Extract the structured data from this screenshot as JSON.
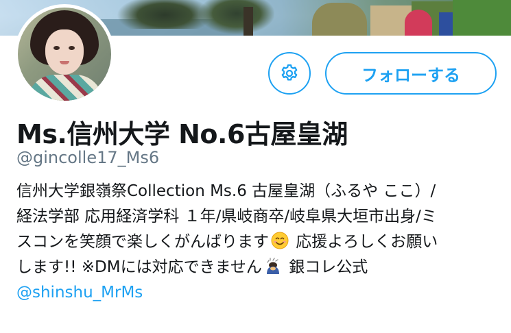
{
  "profile": {
    "display_name": "Ms.信州大学 No.6古屋皇湖",
    "handle": "@gincolle17_Ms6",
    "bio": {
      "line1": "信州大学銀嶺祭Collection Ms.6 古屋皇湖（ふるや ここ）/",
      "line2": "経法学部 応用経済学科 １年/県岐商卒/岐阜県大垣市出身/ミ",
      "line3_a": "スコンを笑顔で楽しくがんばります",
      "line3_b": " 応援よろしくお願い",
      "line4_a": "します!! ※DMには対応できません",
      "line4_b": " 銀コレ公式",
      "mention": "@shinshu_MrMs"
    }
  },
  "actions": {
    "follow_label": "フォローする",
    "settings_icon": "gear-icon"
  },
  "icons": {
    "smile_emoji": "smiling-face-emoji",
    "bow_emoji": "bowing-person-emoji"
  },
  "colors": {
    "accent": "#1da1f2",
    "text": "#14171a",
    "muted": "#657786"
  }
}
